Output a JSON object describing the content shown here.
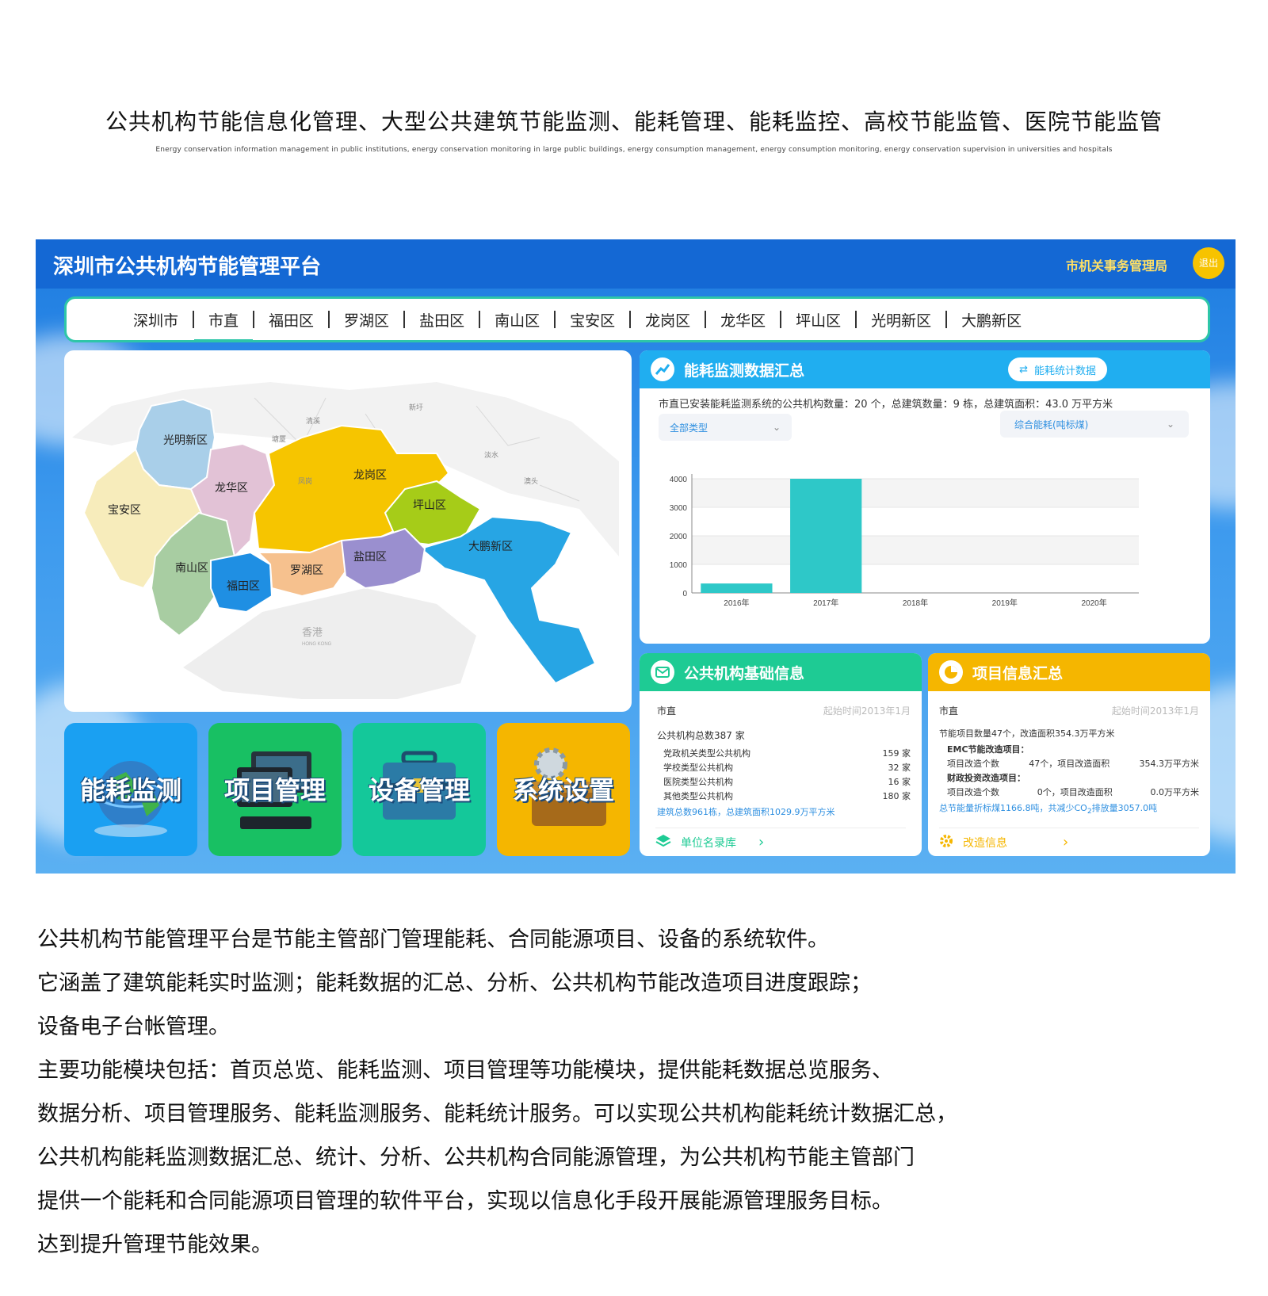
{
  "header": {
    "title": "公共机构节能信息化管理、大型公共建筑节能监测、能耗管理、能耗监控、高校节能监管、医院节能监管",
    "subtitle": "Energy conservation information management in public institutions, energy conservation monitoring in large public buildings, energy consumption management, energy consumption monitoring, energy conservation supervision in universities and hospitals"
  },
  "app": {
    "title": "深圳市公共机构节能管理平台",
    "org": "市机关事务管理局",
    "logout": "退出"
  },
  "nav": {
    "items": [
      "深圳市",
      "市直",
      "福田区",
      "罗湖区",
      "盐田区",
      "南山区",
      "宝安区",
      "龙岗区",
      "龙华区",
      "坪山区",
      "光明新区",
      "大鹏新区"
    ],
    "active_index": 1
  },
  "map": {
    "districts": {
      "guangming": "光明新区",
      "baoan": "宝安区",
      "longhua": "龙华区",
      "longgang": "龙岗区",
      "pingshan": "坪山区",
      "dapeng": "大鹏新区",
      "nanshan": "南山区",
      "futian": "福田区",
      "luohu": "罗湖区",
      "yantian": "盐田区"
    },
    "places": {
      "hk": "香港",
      "hk_en": "HONG KONG",
      "xinxu": "新圩",
      "qinghu": "清溪",
      "tangxia": "塘厦",
      "fenggang": "凤岗",
      "danshui": "淡水",
      "aotou": "澳头"
    },
    "colors": {
      "guangming": "#a9cfe9",
      "baoan": "#f7ecbb",
      "longhua": "#e2c2d6",
      "longgang": "#f6c500",
      "pingshan": "#a6cc18",
      "dapeng": "#27a5e4",
      "nanshan": "#a8cda2",
      "futian": "#1f8fe3",
      "luohu": "#f6c18e",
      "yantian": "#9a8fcf"
    }
  },
  "tiles": [
    {
      "label": "能耗监测",
      "color": "#1aa0f2",
      "icon": "globe-icon"
    },
    {
      "label": "项目管理",
      "color": "#18c063",
      "icon": "computer-icon"
    },
    {
      "label": "设备管理",
      "color": "#14c89a",
      "icon": "toolbox-icon"
    },
    {
      "label": "系统设置",
      "color": "#f5b600",
      "icon": "gear-icon"
    }
  ],
  "energy_card": {
    "title": "能耗监测数据汇总",
    "stats_button": "能耗统计数据",
    "summary": "市直已安装能耗监测系统的公共机构数量：20 个，总建筑数量：9 栋，总建筑面积：43.0 万平方米",
    "type_select": "全部类型",
    "metric_select": "综合能耗(吨标煤)",
    "header_color": "#20aef0"
  },
  "chart_data": {
    "type": "bar",
    "categories": [
      "2016年",
      "2017年",
      "2018年",
      "2019年",
      "2020年"
    ],
    "values": [
      330,
      4000,
      0,
      0,
      0
    ],
    "ylim": [
      0,
      4000
    ],
    "yticks": [
      0,
      1000,
      2000,
      3000,
      4000
    ],
    "bar_color": "#2ec8c8",
    "grid": true
  },
  "basic_info": {
    "title": "公共机构基础信息",
    "header_color": "#1ecb94",
    "scope": "市直",
    "start": "起始时间2013年1月",
    "total": "公共机构总数387 家",
    "rows": [
      {
        "label": "党政机关类型公共机构",
        "value": "159 家"
      },
      {
        "label": "学校类型公共机构",
        "value": "32 家"
      },
      {
        "label": "医院类型公共机构",
        "value": "16 家"
      },
      {
        "label": "其他类型公共机构",
        "value": "180 家"
      }
    ],
    "buildings": "建筑总数961栋，总建筑面积1029.9万平方米",
    "link": "单位名录库",
    "chevron": "›"
  },
  "project_info": {
    "title": "项目信息汇总",
    "header_color": "#f5b600",
    "scope": "市直",
    "start": "起始时间2013年1月",
    "summary": "节能项目数量47个，改造面积354.3万平方米",
    "emc_title": "EMC节能改造项目：",
    "emc_count_label": "项目改造个数",
    "emc_count": "47个，项目改造面积",
    "emc_area": "354.3万平方米",
    "fin_title": "财政投资改造项目：",
    "fin_count_label": "项目改造个数",
    "fin_count": "0个，项目改造面积",
    "fin_area": "0.0万平方米",
    "savings_a": "总节能量折标煤1166.8吨，共减少CO",
    "savings_sub": "2",
    "savings_b": "排放量3057.0吨",
    "link": "改造信息",
    "chevron": "›"
  },
  "description": [
    "公共机构节能管理平台是节能主管部门管理能耗、合同能源项目、设备的系统软件。",
    "它涵盖了建筑能耗实时监测；能耗数据的汇总、分析、公共机构节能改造项目进度跟踪；",
    "设备电子台帐管理。",
    "主要功能模块包括：首页总览、能耗监测、项目管理等功能模块，提供能耗数据总览服务、",
    "数据分析、项目管理服务、能耗监测服务、能耗统计服务。可以实现公共机构能耗统计数据汇总，",
    "公共机构能耗监测数据汇总、统计、分析、公共机构合同能源管理，为公共机构节能主管部门",
    "提供一个能耗和合同能源项目管理的软件平台，实现以信息化手段开展能源管理服务目标。",
    "达到提升管理节能效果。"
  ]
}
